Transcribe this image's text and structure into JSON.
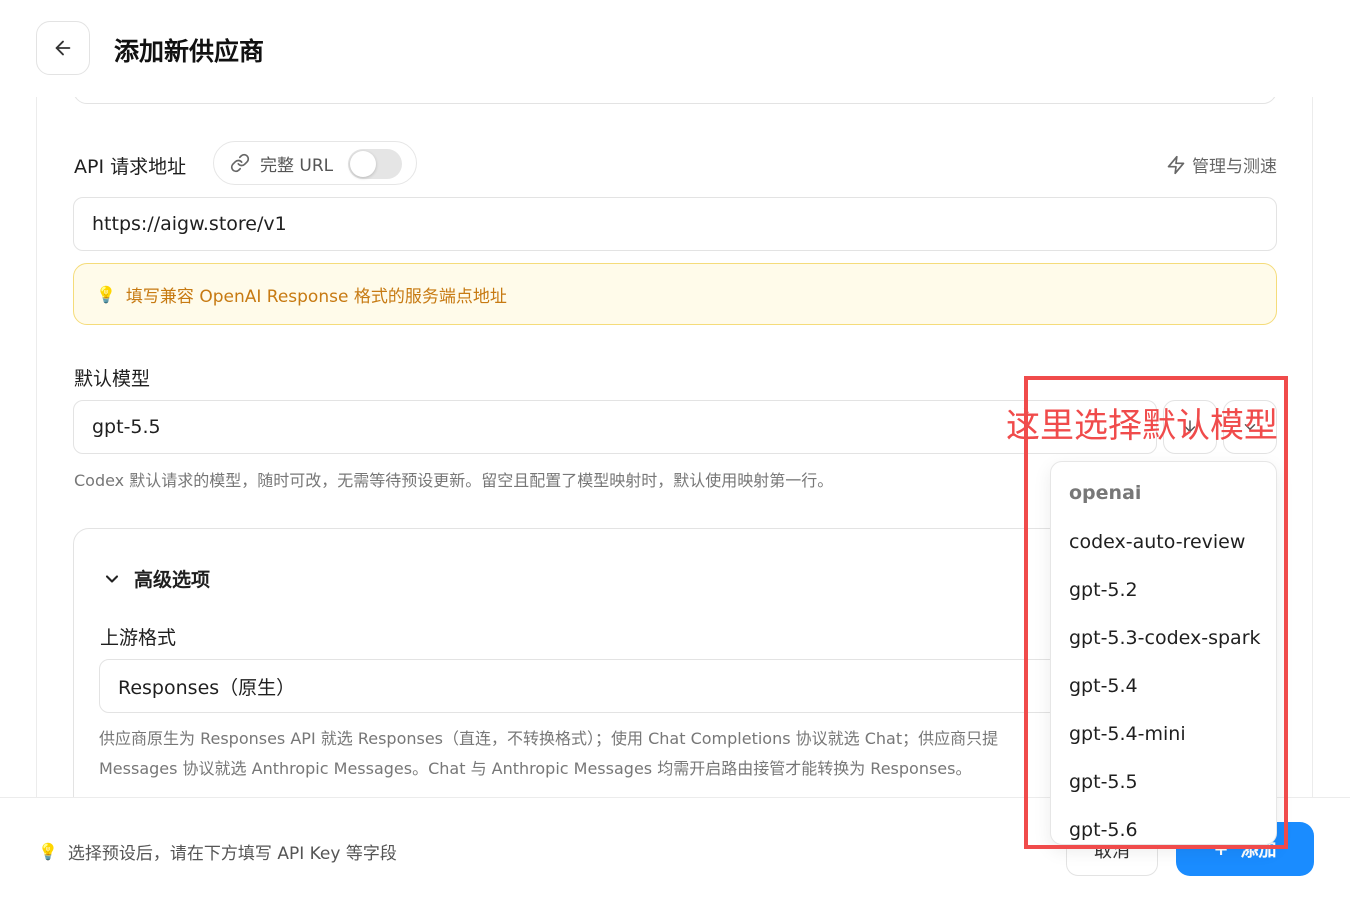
{
  "header": {
    "title": "添加新供应商"
  },
  "api": {
    "label": "API 请求地址",
    "full_url_label": "完整 URL",
    "full_url_enabled": false,
    "manage_label": "管理与测速",
    "url_value": "https://aigw.store/v1",
    "hint": "填写兼容 OpenAI Response 格式的服务端点地址"
  },
  "model": {
    "label": "默认模型",
    "value": "gpt-5.5",
    "help": "Codex 默认请求的模型，随时可改，无需等待预设更新。留空且配置了模型映射时，默认使用映射第一行。"
  },
  "advanced": {
    "title": "高级选项",
    "upstream_label": "上游格式",
    "upstream_value": "Responses（原生）",
    "upstream_help_line1": "供应商原生为 Responses API 就选 Responses（直连，不转换格式）；使用 Chat Completions 协议就选 Chat；供应商只提",
    "upstream_help_line2": "Messages 协议就选 Anthropic Messages。Chat 与 Anthropic Messages 均需开启路由接管才能转换为 Responses。"
  },
  "dropdown": {
    "group": "openai",
    "items": [
      "codex-auto-review",
      "gpt-5.2",
      "gpt-5.3-codex-spark",
      "gpt-5.4",
      "gpt-5.4-mini",
      "gpt-5.5",
      "gpt-5.6"
    ]
  },
  "footer": {
    "hint": "选择预设后，请在下方填写 API Key 等字段",
    "cancel_label": "取消",
    "add_label": "添加"
  },
  "annotation": {
    "text": "这里选择默认模型",
    "color": "#f04b4b"
  },
  "colors": {
    "accent": "#1a8cff",
    "hint_text": "#c77a12",
    "hint_bg": "#fffbea"
  }
}
